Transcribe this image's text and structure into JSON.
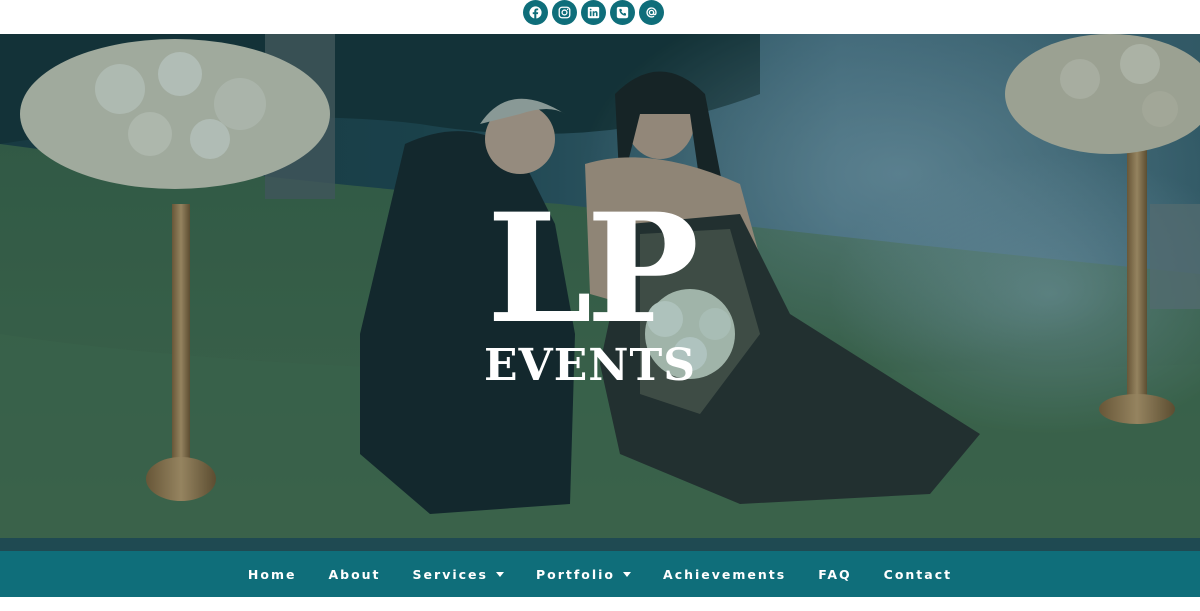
{
  "social": [
    {
      "icon": "facebook-icon"
    },
    {
      "icon": "instagram-icon"
    },
    {
      "icon": "linkedin-icon"
    },
    {
      "icon": "phone-icon"
    },
    {
      "icon": "email-at-icon"
    }
  ],
  "logo": {
    "monogram": "LP",
    "word": "EVENTS"
  },
  "nav": {
    "items": [
      {
        "label": "Home",
        "dropdown": false
      },
      {
        "label": "About",
        "dropdown": false
      },
      {
        "label": "Services",
        "dropdown": true
      },
      {
        "label": "Portfolio",
        "dropdown": true
      },
      {
        "label": "Achievements",
        "dropdown": false
      },
      {
        "label": "FAQ",
        "dropdown": false
      },
      {
        "label": "Contact",
        "dropdown": false
      }
    ]
  },
  "colors": {
    "brand_teal": "#0f6e7a",
    "logo_text": "#ffffff"
  }
}
